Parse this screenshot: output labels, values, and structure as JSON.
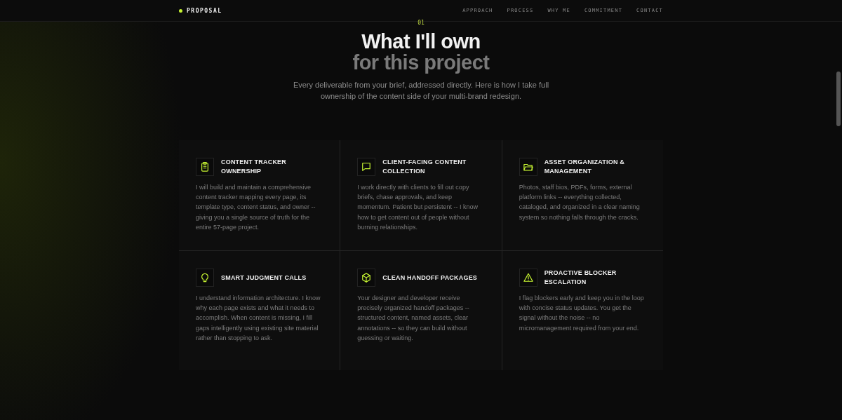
{
  "nav": {
    "brand": "PROPOSAL",
    "links": [
      "APPROACH",
      "PROCESS",
      "WHY ME",
      "COMMITMENT",
      "CONTACT"
    ]
  },
  "section": {
    "number": "01",
    "title_line_1": "What I'll own",
    "title_line_2": "for this project",
    "intro": "Every deliverable from your brief, addressed directly. Here is how I take full ownership of the content side of your multi-brand redesign."
  },
  "cards": [
    {
      "title": "CONTENT TRACKER OWNERSHIP",
      "body": "I will build and maintain a comprehensive content tracker mapping every page, its template type, content status, and owner -- giving you a single source of truth for the entire 57-page project."
    },
    {
      "title": "CLIENT-FACING CONTENT COLLECTION",
      "body": "I work directly with clients to fill out copy briefs, chase approvals, and keep momentum. Patient but persistent -- I know how to get content out of people without burning relationships."
    },
    {
      "title": "ASSET ORGANIZATION & MANAGEMENT",
      "body": "Photos, staff bios, PDFs, forms, external platform links -- everything collected, cataloged, and organized in a clear naming system so nothing falls through the cracks."
    },
    {
      "title": "SMART JUDGMENT CALLS",
      "body": "I understand information architecture. I know why each page exists and what it needs to accomplish. When content is missing, I fill gaps intelligently using existing site material rather than stopping to ask."
    },
    {
      "title": "CLEAN HANDOFF PACKAGES",
      "body": "Your designer and developer receive precisely organized handoff packages -- structured content, named assets, clear annotations -- so they can build without guessing or waiting."
    },
    {
      "title": "PROACTIVE BLOCKER ESCALATION",
      "body": "I flag blockers early and keep you in the loop with concise status updates. You get the signal without the noise -- no micromanagement required from your end."
    }
  ]
}
